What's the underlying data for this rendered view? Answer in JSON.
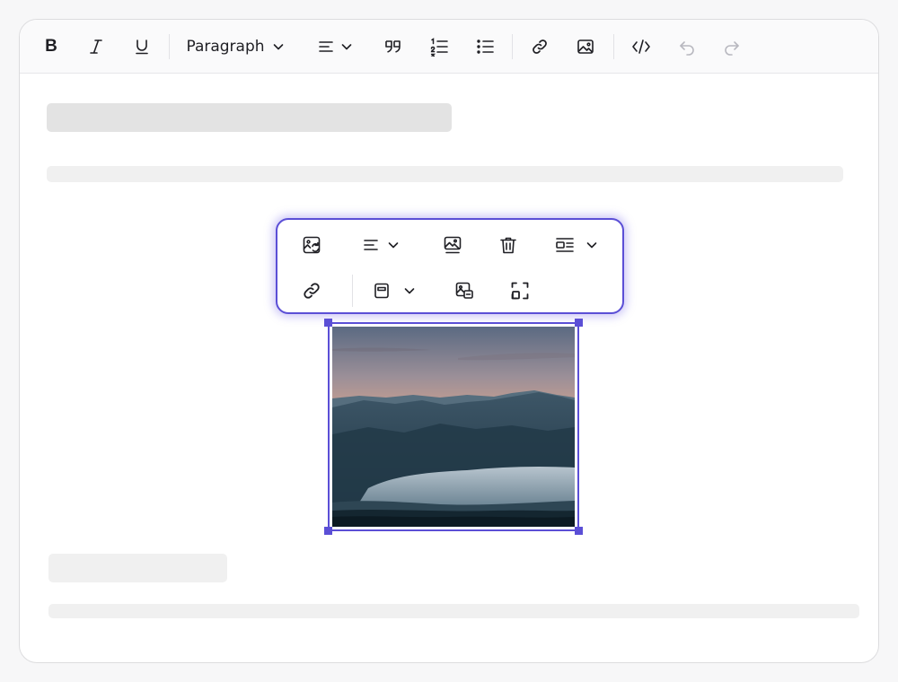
{
  "toolbar": {
    "bold_label": "B",
    "block_type_selected": "Paragraph",
    "icons": [
      "bold-icon",
      "italic-icon",
      "underline-icon",
      "chevron-down-icon",
      "align-left-icon",
      "quote-icon",
      "ordered-list-icon",
      "bullet-list-icon",
      "link-icon",
      "image-icon",
      "code-icon",
      "undo-icon",
      "redo-icon"
    ]
  },
  "image_toolbar": {
    "icons": [
      "replace-image-icon",
      "align-left-icon",
      "image-caption-icon",
      "trash-icon",
      "text-wrap-icon",
      "link-icon",
      "image-size-icon",
      "image-alt-icon",
      "resize-icon"
    ]
  },
  "image": {
    "subject": "mountain-landscape-photo",
    "selected": true
  },
  "colors": {
    "accent": "#5b4fd6",
    "placeholder_dark": "#e3e3e3",
    "placeholder_light": "#f0f0f0"
  }
}
